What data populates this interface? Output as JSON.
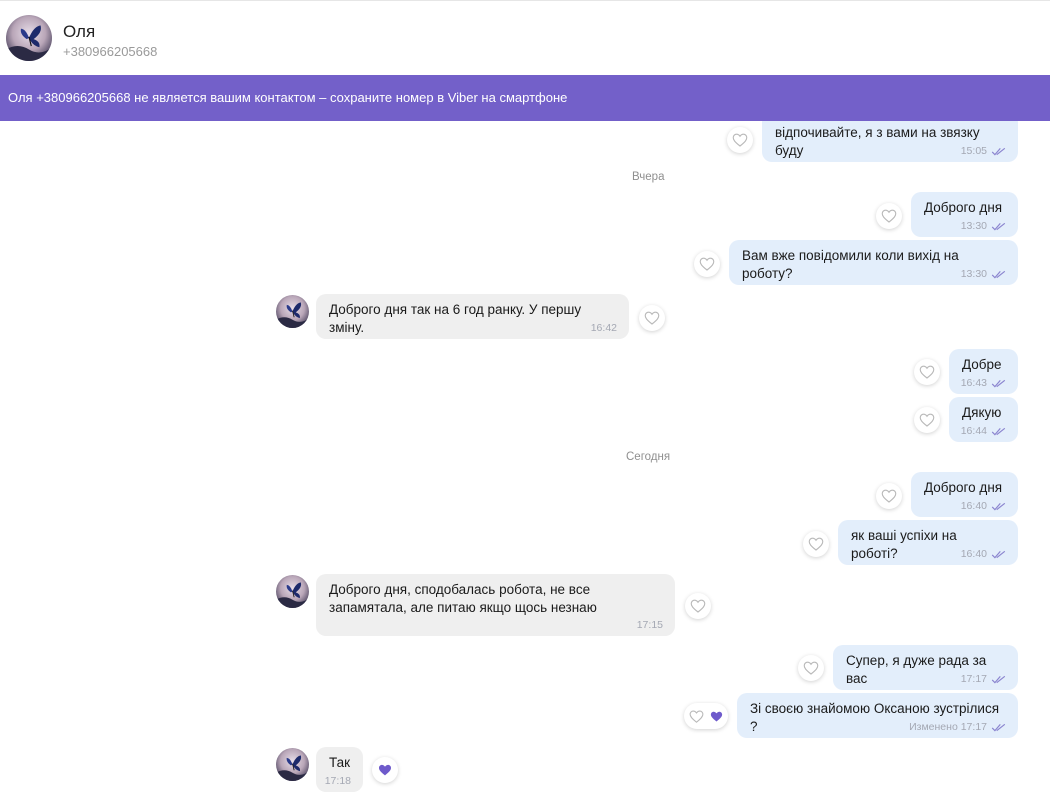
{
  "header": {
    "name": "Оля",
    "phone": "+380966205668"
  },
  "banner": {
    "text": "Оля +380966205668 не является вашим контактом – сохраните номер в Viber на смартфоне"
  },
  "dates": {
    "yesterday": "Вчера",
    "today": "Сегодня"
  },
  "messages": [
    {
      "dir": "out",
      "text": "відпочивайте, я з вами на звязку буду",
      "time": "15:05"
    },
    {
      "dir": "out",
      "text": "Доброго дня",
      "time": "13:30"
    },
    {
      "dir": "out",
      "text": "Вам вже повідомили коли вихід на роботу?",
      "time": "13:30"
    },
    {
      "dir": "in",
      "text": "Доброго дня так на 6 год ранку. У першу зміну.",
      "time": "16:42"
    },
    {
      "dir": "out",
      "text": "Добре",
      "time": "16:43"
    },
    {
      "dir": "out",
      "text": "Дякую",
      "time": "16:44"
    },
    {
      "dir": "out",
      "text": "Доброго дня",
      "time": "16:40"
    },
    {
      "dir": "out",
      "text": "як ваші успіхи на роботі?",
      "time": "16:40"
    },
    {
      "dir": "in",
      "text1": "Доброго дня, сподобалась робота, не все",
      "text2": "запамятала, але питаю якщо щось незнаю",
      "time": "17:15"
    },
    {
      "dir": "out",
      "text": "Супер, я дуже рада за вас",
      "time": "17:17"
    },
    {
      "dir": "out",
      "text": "Зі своєю знайомою Оксаною зустрілися ?",
      "edited": "Изменено",
      "time": "17:17"
    },
    {
      "dir": "in",
      "text": "Так",
      "time": "17:18"
    }
  ],
  "colors": {
    "accent": "#7360c9",
    "outgoing_bubble": "#e3eefb",
    "incoming_bubble": "#efefef",
    "tick": "#8a84cf",
    "liked_heart": "#6e5acb"
  },
  "icons": {
    "heart": "heart-icon",
    "heart_liked": "filled-heart-icon",
    "read": "double-check-icon",
    "avatar": "butterfly-avatar"
  }
}
